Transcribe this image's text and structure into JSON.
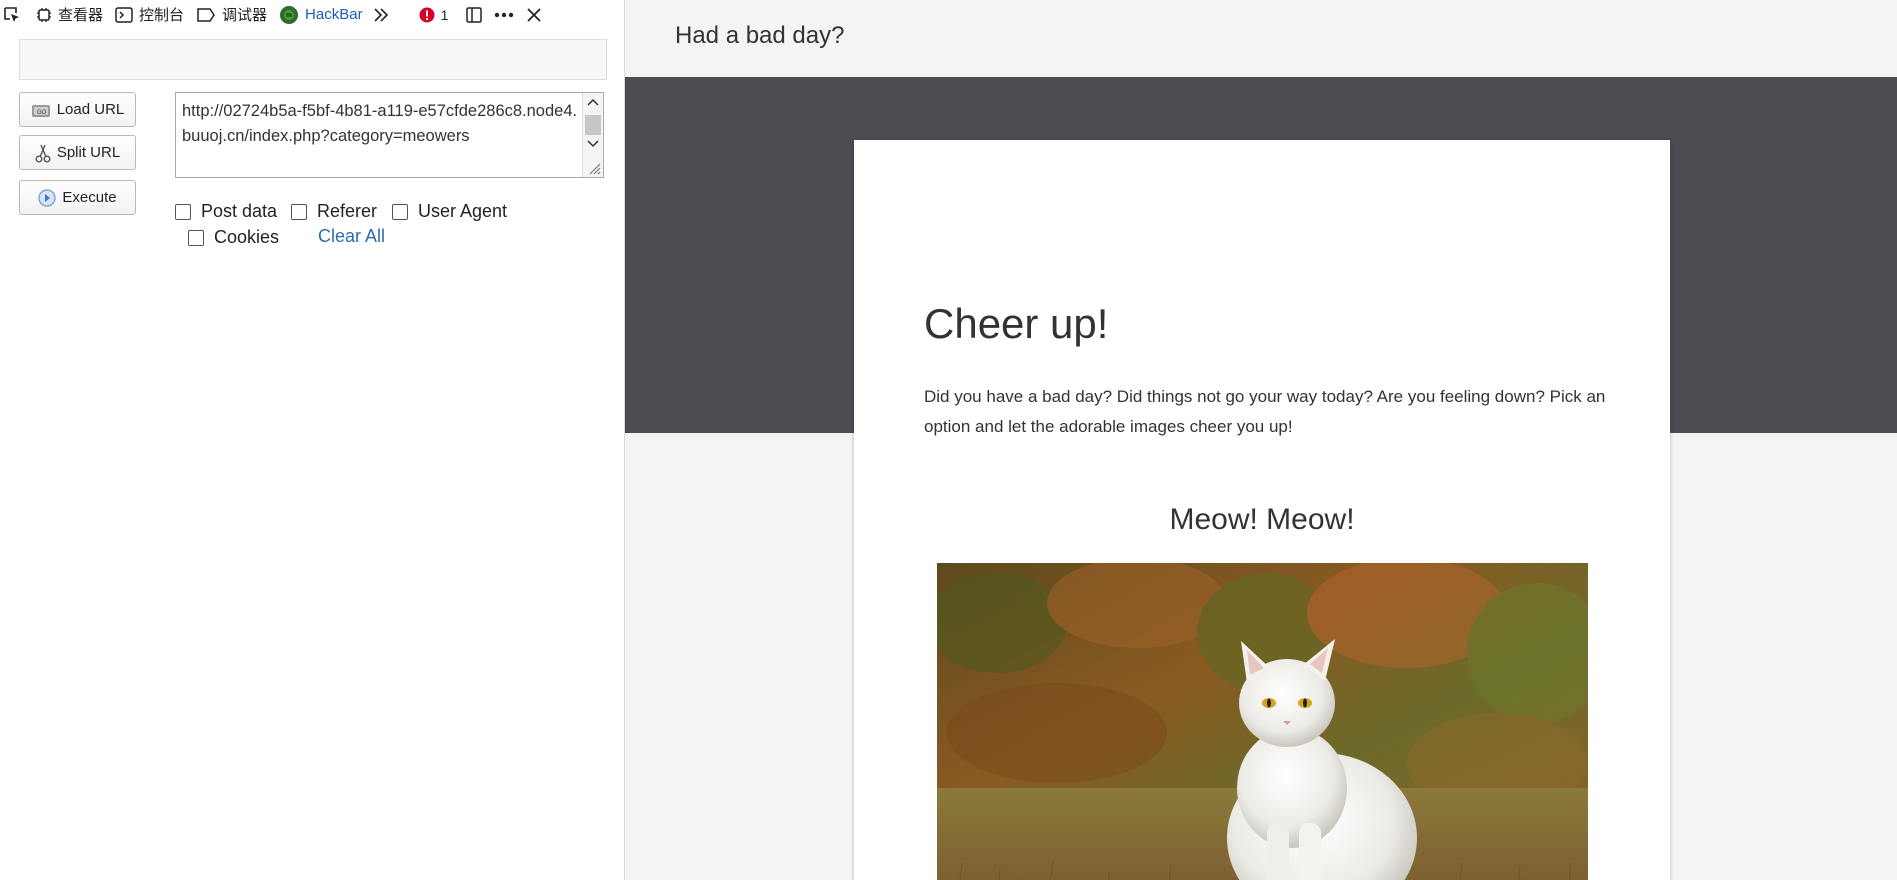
{
  "devtools": {
    "tabs": [
      {
        "label": "查看器",
        "icon": "inspector-icon"
      },
      {
        "label": "控制台",
        "icon": "console-icon"
      },
      {
        "label": "调试器",
        "icon": "debugger-icon"
      },
      {
        "label": "HackBar",
        "icon": "hackbar-icon",
        "active": true
      }
    ],
    "error_count": "1",
    "accent_color": "#1a5fb4",
    "error_color": "#d70022"
  },
  "hackbar": {
    "buttons": {
      "load": "Load URL",
      "split": "Split URL",
      "execute": "Execute"
    },
    "url": "http://02724b5a-f5bf-4b81-a119-e57cfde286c8.node4.buuoj.cn/index.php?category=meowers",
    "options": {
      "post": "Post data",
      "referer": "Referer",
      "user_agent": "User Agent",
      "cookies": "Cookies"
    },
    "clear_all": "Clear All"
  },
  "page": {
    "site_title": "Had a bad day?",
    "heading": "Cheer up!",
    "intro": "Did you have a bad day? Did things not go your way today? Are you feeling down? Pick an option and let the adorable images cheer you up!",
    "picture_title": "Meow! Meow!",
    "hero_color": "#4a4c50"
  }
}
